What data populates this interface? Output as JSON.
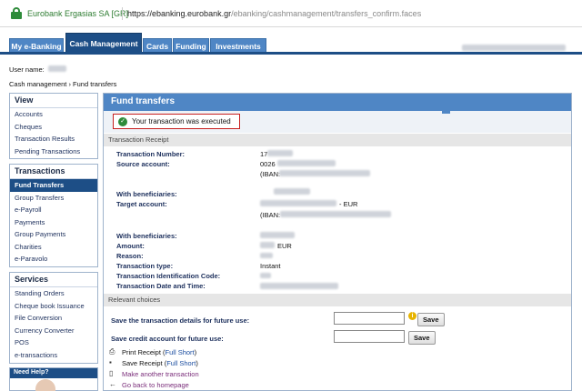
{
  "browser": {
    "site_identity": "Eurobank Ergasias SA [GR]",
    "url_domain": "https://ebanking.eurobank.gr",
    "url_path": "/ebanking/cashmanagement/transfers_confirm.faces"
  },
  "tabs": [
    "My e-Banking",
    "Cash Management",
    "Cards",
    "Funding",
    "Investments"
  ],
  "active_tab": "Cash Management",
  "user_name_label": "User name:",
  "breadcrumb": "Cash management › Fund transfers",
  "sidebar": {
    "view": {
      "heading": "View",
      "items": [
        "Accounts",
        "Cheques",
        "Transaction Results",
        "Pending Transactions"
      ]
    },
    "transactions": {
      "heading": "Transactions",
      "items": [
        "Fund Transfers",
        "Group Transfers",
        "e-Payroll",
        "Payments",
        "Group Payments",
        "Charities",
        "e-Paravolo"
      ],
      "active": "Fund Transfers"
    },
    "services": {
      "heading": "Services",
      "items": [
        "Standing Orders",
        "Cheque book Issuance",
        "File Conversion",
        "Currency Converter",
        "POS",
        "e-transactions"
      ]
    },
    "help": "Need Help?"
  },
  "main": {
    "title": "Fund transfers",
    "success_message": "Your transaction was executed",
    "receipt_heading": "Transaction Receipt",
    "fields": {
      "transaction_number": {
        "label": "Transaction Number:",
        "value": "17"
      },
      "source_account": {
        "label": "Source account:",
        "value": "0026",
        "iban": "(IBAN:"
      },
      "with_beneficiaries_1": {
        "label": "With beneficiaries:"
      },
      "target_account": {
        "label": "Target account:",
        "currency": "- EUR",
        "iban": "(IBAN:"
      },
      "with_beneficiaries_2": {
        "label": "With beneficiaries:"
      },
      "amount": {
        "label": "Amount:",
        "value": "EUR"
      },
      "reason": {
        "label": "Reason:"
      },
      "transaction_type": {
        "label": "Transaction type:",
        "value": "Instant"
      },
      "transaction_id_code": {
        "label": "Transaction Identification Code:"
      },
      "transaction_datetime": {
        "label": "Transaction Date and Time:"
      }
    },
    "relevant_heading": "Relevant choices",
    "save_details_label": "Save the transaction details for future use:",
    "save_credit_label": "Save credit account for future use:",
    "save_button": "Save",
    "actions": {
      "print_receipt": "Print Receipt",
      "save_receipt": "Save Receipt",
      "full_short": "Full Short",
      "open_paren": "(",
      "close_paren": ")",
      "make_another": "Make another transaction",
      "go_home": "Go back to homepage"
    }
  }
}
